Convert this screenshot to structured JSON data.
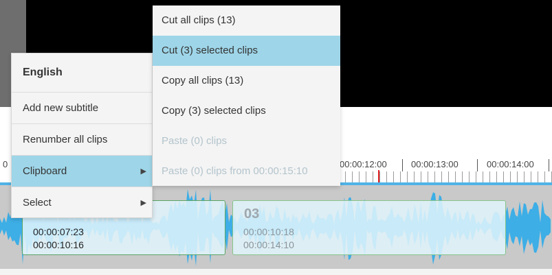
{
  "ruler": {
    "labels": [
      "0",
      "00:00:12:00",
      "00:00:13:00",
      "00:00:14:00"
    ]
  },
  "clips": [
    {
      "number": "",
      "start": "00:00:07:23",
      "end": "00:00:10:16"
    },
    {
      "number": "03",
      "start": "00:00:10:18",
      "end": "00:00:14:10"
    }
  ],
  "context_menu": {
    "header": "English",
    "items": [
      {
        "label": "Add new subtitle"
      },
      {
        "label": "Renumber all clips"
      },
      {
        "label": "Clipboard",
        "active": true,
        "has_submenu": true
      },
      {
        "label": "Select",
        "has_submenu": true
      }
    ]
  },
  "clipboard_submenu": {
    "items": [
      {
        "label": "Cut all clips (13)"
      },
      {
        "label": "Cut (3) selected clips",
        "highlighted": true
      },
      {
        "label": "Copy all clips (13)"
      },
      {
        "label": "Copy (3) selected clips"
      },
      {
        "label": "Paste (0) clips",
        "disabled": true
      },
      {
        "label": "Paste (0) clips from 00:00:15:10",
        "disabled": true
      }
    ]
  },
  "colors": {
    "menu_active": "#9ed5e8",
    "waveform": "#3daee6",
    "playhead": "#e32222",
    "clip_border": "#5aa463"
  }
}
